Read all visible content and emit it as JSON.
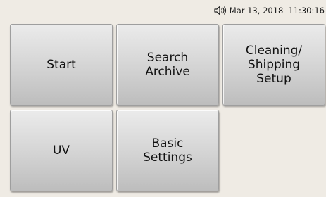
{
  "status": {
    "sound_icon": "speaker-icon",
    "date": "Mar 13, 2018",
    "time": "11:30:16"
  },
  "menu": {
    "tiles": [
      {
        "label": "Start"
      },
      {
        "label": "Search\nArchive"
      },
      {
        "label": "Cleaning/\nShipping\nSetup"
      },
      {
        "label": "UV"
      },
      {
        "label": "Basic\nSettings"
      }
    ]
  }
}
